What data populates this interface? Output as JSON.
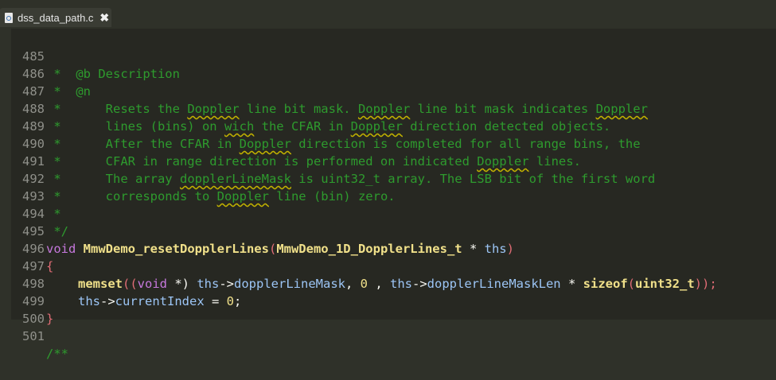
{
  "tab": {
    "label": "dss_data_path.c",
    "close_glyph": "✖",
    "icon": "c-file-icon"
  },
  "lines": [
    {
      "n": "485"
    },
    {
      "n": "486"
    },
    {
      "n": "487"
    },
    {
      "n": "488"
    },
    {
      "n": "489"
    },
    {
      "n": "490"
    },
    {
      "n": "491"
    },
    {
      "n": "492"
    },
    {
      "n": "493"
    },
    {
      "n": "494"
    },
    {
      "n": "495"
    },
    {
      "n": "496"
    },
    {
      "n": "497"
    },
    {
      "n": "498"
    },
    {
      "n": "499"
    },
    {
      "n": "500"
    },
    {
      "n": "501"
    }
  ],
  "code": {
    "l485": " *  @b Description",
    "l486": " *  @n",
    "l487a": " *      Resets the ",
    "l487b": "Doppler",
    "l487c": " line bit mask. ",
    "l487d": "Doppler",
    "l487e": " line bit mask indicates ",
    "l487f": "Doppler",
    "l488a": " *      lines (bins) on ",
    "l488b": "wich",
    "l488c": " the CFAR in ",
    "l488d": "Doppler",
    "l488e": " direction detected objects.",
    "l489a": " *      After the CFAR in ",
    "l489b": "Doppler",
    "l489c": " direction is completed for all range bins, the",
    "l490a": " *      CFAR in range direction is performed on indicated ",
    "l490b": "Doppler",
    "l490c": " lines.",
    "l491a": " *      The array ",
    "l491b": "dopplerLineMask",
    "l491c": " is uint32_t array. The LSB bit of the first word",
    "l492a": " *      corresponds to ",
    "l492b": "Doppler",
    "l492c": " line (bin) zero.",
    "l493": " *",
    "l494": " */",
    "l495_void": "void",
    "l495_fn": "MmwDemo_resetDopplerLines",
    "l495_lp": "(",
    "l495_ty": "MmwDemo_1D_DopplerLines_t",
    "l495_star": " * ",
    "l495_arg": "ths",
    "l495_rp": ")",
    "l496": "{",
    "l497_fn": "memset",
    "l497_lp": "((",
    "l497_void": "void",
    "l497_star": " *) ",
    "l497_ths1": "ths",
    "l497_arrow1": "->",
    "l497_m1": "dopplerLineMask",
    "l497_c1": ", ",
    "l497_zero": "0",
    "l497_c2": " , ",
    "l497_ths2": "ths",
    "l497_arrow2": "->",
    "l497_m2": "dopplerLineMaskLen",
    "l497_mul": " * ",
    "l497_sizeof": "sizeof",
    "l497_lp2": "(",
    "l497_ty": "uint32_t",
    "l497_rp": "));",
    "l498_ths": "ths",
    "l498_arrow": "->",
    "l498_m": "currentIndex",
    "l498_eq": " = ",
    "l498_zero": "0",
    "l498_end": ";",
    "l499": "}",
    "l500": "",
    "l501": "/**"
  }
}
